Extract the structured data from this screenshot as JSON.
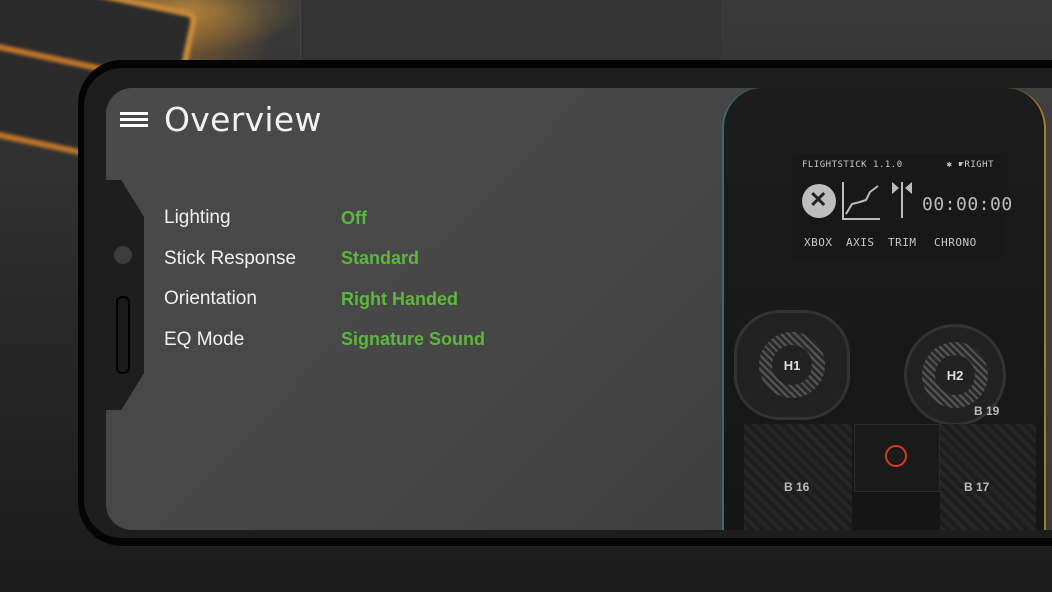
{
  "header": {
    "title": "Overview",
    "menu_icon": "hamburger-menu-icon"
  },
  "settings": [
    {
      "label": "Lighting",
      "value": "Off"
    },
    {
      "label": "Stick Response",
      "value": "Standard"
    },
    {
      "label": "Orientation",
      "value": "Right Handed"
    },
    {
      "label": "EQ Mode",
      "value": "Signature Sound"
    }
  ],
  "device": {
    "lcd": {
      "firmware": "FLIGHTSTICK 1.1.0",
      "status": "✱ ☛RIGHT",
      "timer": "00:00:00",
      "tabs": [
        "XBOX",
        "AXIS",
        "TRIM",
        "CHRONO"
      ]
    },
    "knobs": [
      "H1",
      "H2"
    ],
    "buttons": [
      "B 16",
      "B 17",
      "B 19"
    ]
  },
  "colors": {
    "accent": "#5cb83c",
    "screen_bg": "#474747",
    "text": "#f0f0f0"
  }
}
